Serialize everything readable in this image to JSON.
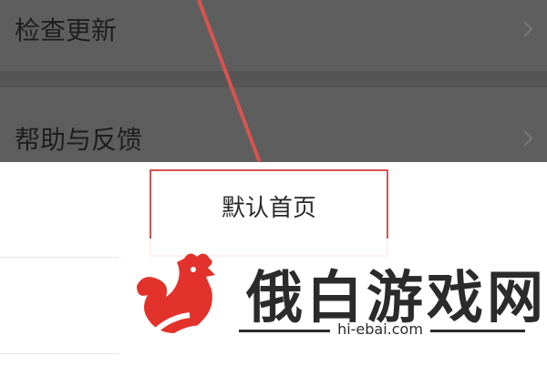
{
  "settings": {
    "items": [
      {
        "label": "检查更新"
      },
      {
        "label": "帮助与反馈"
      }
    ]
  },
  "popup": {
    "option_label": "默认首页"
  },
  "watermark": {
    "title": "俄白游戏网",
    "url": "hi-ebai.com"
  },
  "colors": {
    "dim_overlay": "#5e5e5e",
    "annotation_red": "#d9534f",
    "logo_red": "#e2322b"
  },
  "icons": {
    "row_chevron": "chevron-right-icon",
    "logo": "rooster-logo"
  }
}
